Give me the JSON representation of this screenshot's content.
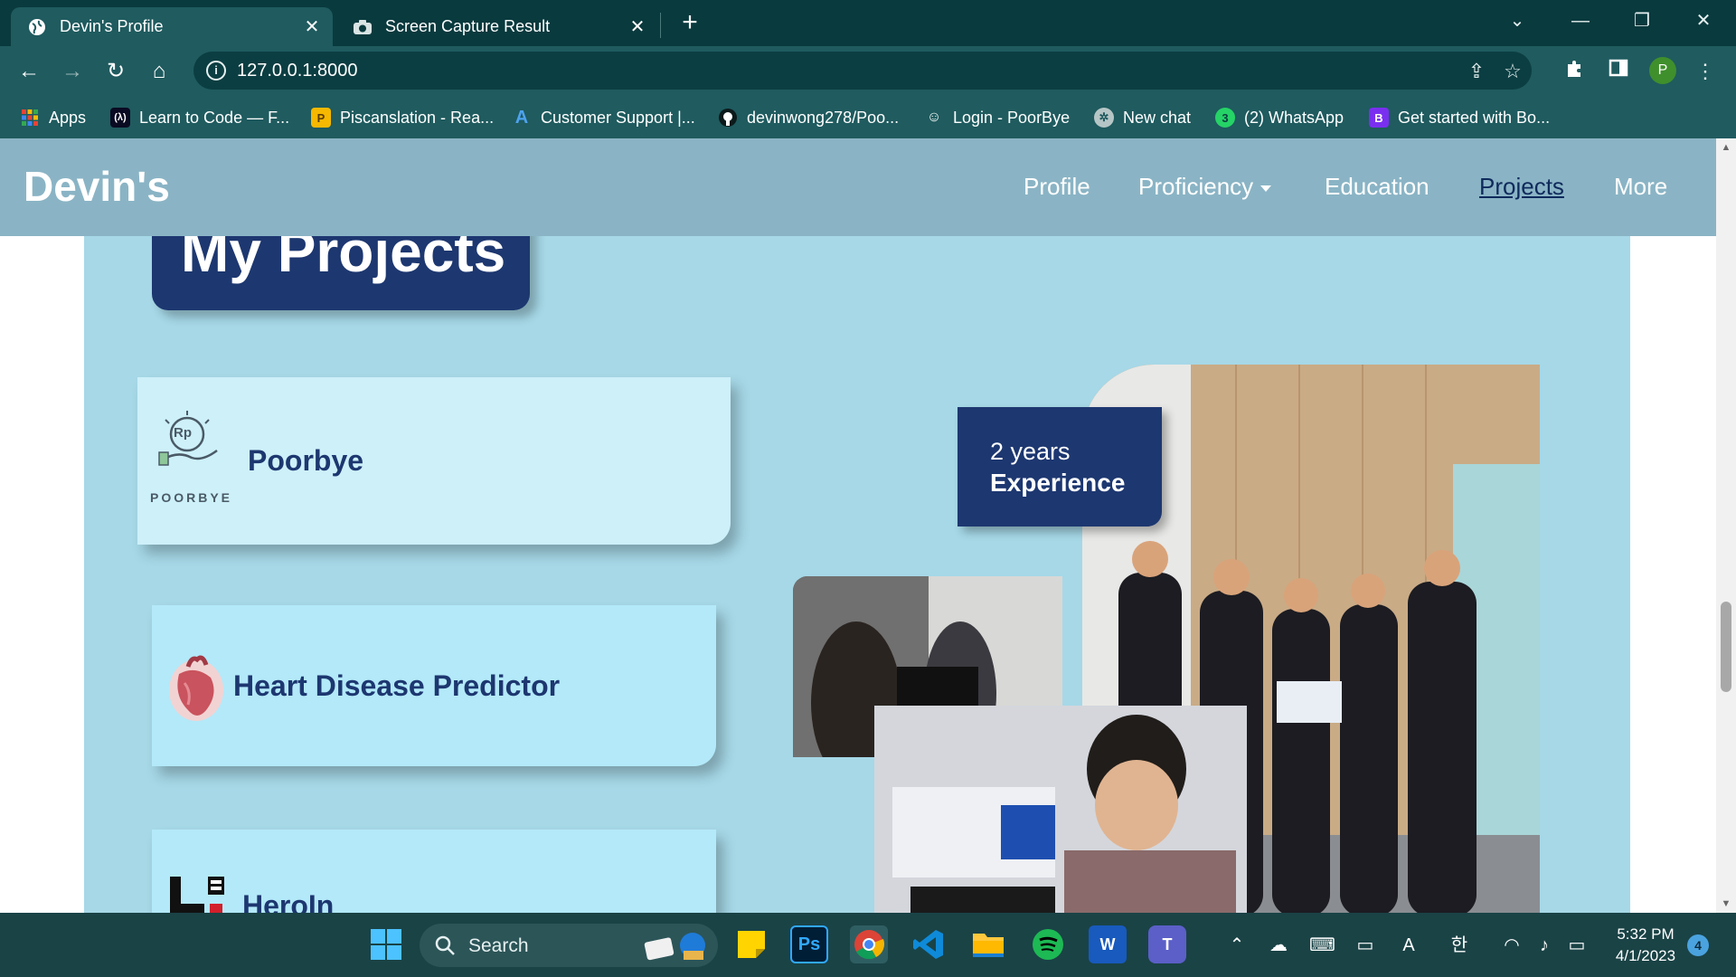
{
  "browser": {
    "tabs": [
      {
        "title": "Devin's Profile",
        "active": true,
        "icon": "globe-icon"
      },
      {
        "title": "Screen Capture Result",
        "active": false,
        "icon": "camera-icon"
      }
    ],
    "url": "127.0.0.1:8000",
    "profile_initial": "P",
    "bookmarks": [
      {
        "label": "Apps",
        "icon": "apps-grid-icon"
      },
      {
        "label": "Learn to Code — F...",
        "icon": "freecodecamp-icon"
      },
      {
        "label": "Piscanslation - Rea...",
        "icon": "piscanslation-icon"
      },
      {
        "label": "Customer Support |...",
        "icon": "support-icon"
      },
      {
        "label": "devinwong278/Poo...",
        "icon": "github-icon"
      },
      {
        "label": "Login - PoorBye",
        "icon": "poorbye-icon"
      },
      {
        "label": "New chat",
        "icon": "chatgpt-icon"
      },
      {
        "label": "(2) WhatsApp",
        "icon": "whatsapp-icon"
      },
      {
        "label": "Get started with Bo...",
        "icon": "bootstrap-icon"
      }
    ]
  },
  "site": {
    "brand": "Devin's",
    "nav": [
      {
        "label": "Profile"
      },
      {
        "label": "Proficiency"
      },
      {
        "label": "Education"
      },
      {
        "label": "Projects"
      },
      {
        "label": "More"
      }
    ],
    "section_title": "My Projects",
    "projects": [
      {
        "name": "Poorbye",
        "logo_text": "POORBYE",
        "logo_mark": "Rp"
      },
      {
        "name": "Heart Disease Predictor"
      },
      {
        "name": "HeroIn"
      }
    ],
    "experience": {
      "years": "2 years",
      "label": "Experience"
    }
  },
  "taskbar": {
    "search_label": "Search",
    "time": "5:32 PM",
    "date": "4/1/2023",
    "notification_count": "4",
    "colors": {
      "accent": "#1d3770",
      "section_bg": "#a6d8e7",
      "nav_bg": "#8ab4c5"
    }
  }
}
